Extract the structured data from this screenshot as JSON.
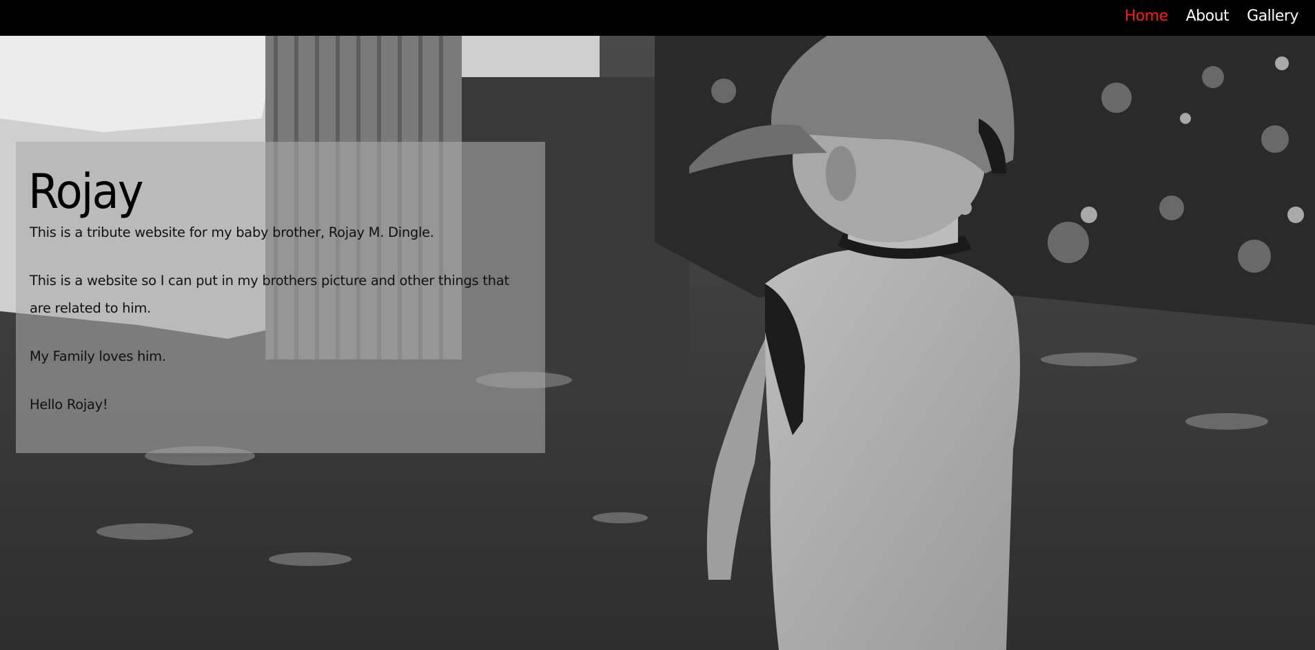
{
  "nav": {
    "items": [
      {
        "label": "Home",
        "active": true
      },
      {
        "label": "About",
        "active": false
      },
      {
        "label": "Gallery",
        "active": false
      }
    ]
  },
  "card": {
    "title": "Rojay",
    "paragraphs": [
      "This is a tribute website for my baby brother, Rojay M. Dingle.",
      "This is a website so I can put in my brothers picture and other things that are related to him.",
      "My Family loves him.",
      "Hello Rojay!"
    ]
  },
  "colors": {
    "navbar_bg": "#000000",
    "nav_active": "#ff1a1a",
    "nav_text": "#ffffff",
    "card_bg": "rgba(170,170,170,0.58)"
  }
}
